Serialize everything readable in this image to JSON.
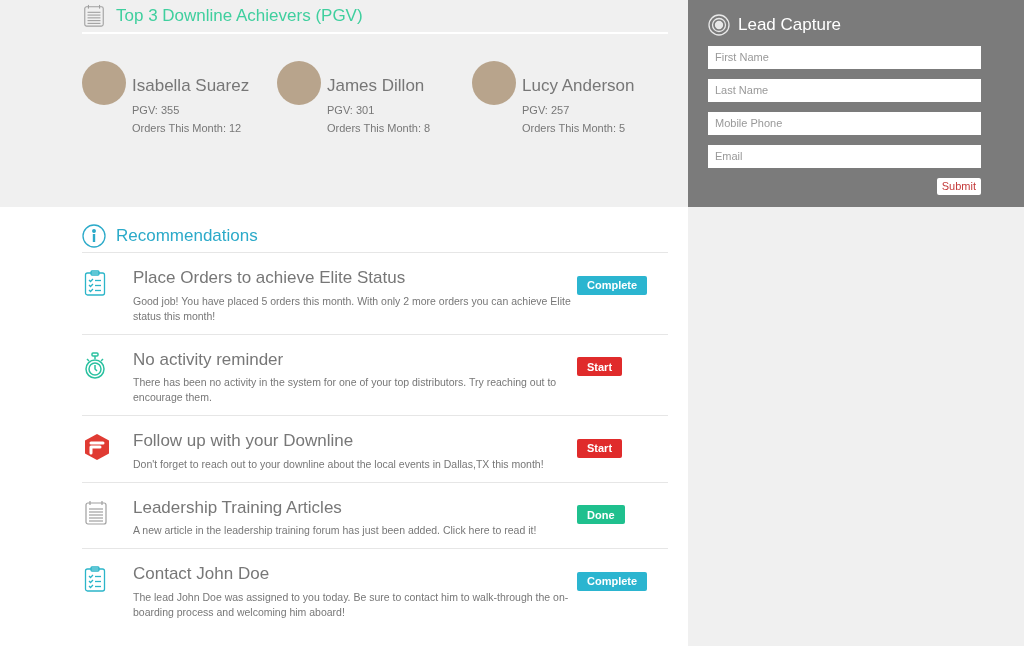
{
  "achievers": {
    "title": "Top 3 Downline Achievers (PGV)",
    "people": [
      {
        "name": "Isabella Suarez",
        "pgv": "PGV: 355",
        "orders": "Orders This Month: 12"
      },
      {
        "name": "James Dillon",
        "pgv": "PGV: 301",
        "orders": "Orders This Month: 8"
      },
      {
        "name": "Lucy Anderson",
        "pgv": "PGV: 257",
        "orders": "Orders This Month: 5"
      }
    ]
  },
  "lead_capture": {
    "title": "Lead Capture",
    "fields": [
      {
        "placeholder": "First Name"
      },
      {
        "placeholder": "Last Name"
      },
      {
        "placeholder": "Mobile Phone"
      },
      {
        "placeholder": "Email"
      }
    ],
    "submit": "Submit"
  },
  "recommendations": {
    "title": "Recommendations",
    "items": [
      {
        "kind": "clipboard",
        "title": "Place Orders to achieve Elite Status",
        "text": "Good job! You have placed 5 orders this month. With only 2 more orders you can achieve Elite status this month!",
        "button": {
          "label": "Complete",
          "color": "#2bb5d0"
        }
      },
      {
        "kind": "stopwatch",
        "title": "No activity reminder",
        "text": "There has been no activity in the system for one of your top distributors. Try reaching out to encourage them.",
        "button": {
          "label": "Start",
          "color": "#e02b2b"
        }
      },
      {
        "kind": "hexagon",
        "title": "Follow up with your Downline",
        "text": "Don't forget to reach out to your downline about the local events in Dallas,TX this month!",
        "button": {
          "label": "Start",
          "color": "#e02b2b"
        }
      },
      {
        "kind": "notepad",
        "title": "Leadership Training Articles",
        "text": "A new article in the leadership training forum has just been added. Click here to read it!",
        "button": {
          "label": "Done",
          "color": "#1fc08e"
        }
      },
      {
        "kind": "clipboard",
        "title": "Contact John Doe",
        "text": "The lead John Doe was assigned to you today. Be sure to contact him to walk-through the on-boarding process and welcoming him aboard!",
        "button": {
          "label": "Complete",
          "color": "#2bb5d0"
        }
      }
    ]
  }
}
